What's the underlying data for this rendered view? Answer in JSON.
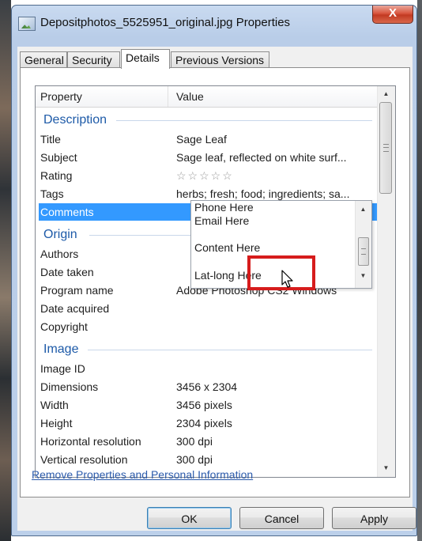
{
  "window": {
    "title": "Depositphotos_5525951_original.jpg Properties",
    "close_label": "X"
  },
  "tabs": [
    {
      "label": "General"
    },
    {
      "label": "Security"
    },
    {
      "label": "Details",
      "active": true
    },
    {
      "label": "Previous Versions"
    }
  ],
  "list": {
    "header": {
      "property": "Property",
      "value": "Value"
    },
    "groups": {
      "description": "Description",
      "origin": "Origin",
      "image": "Image"
    },
    "description_rows": [
      {
        "property": "Title",
        "value": "Sage Leaf"
      },
      {
        "property": "Subject",
        "value": "Sage leaf, reflected on white surf..."
      },
      {
        "property": "Rating",
        "value": "☆☆☆☆☆"
      },
      {
        "property": "Tags",
        "value": "herbs; fresh; food; ingredients; sa..."
      },
      {
        "property": "Comments",
        "value": ""
      }
    ],
    "origin_rows": [
      {
        "property": "Authors",
        "value": ""
      },
      {
        "property": "Date taken",
        "value": ""
      },
      {
        "property": "Program name",
        "value": "Adobe Photoshop CS2 Windows"
      },
      {
        "property": "Date acquired",
        "value": ""
      },
      {
        "property": "Copyright",
        "value": ""
      }
    ],
    "image_rows": [
      {
        "property": "Image ID",
        "value": ""
      },
      {
        "property": "Dimensions",
        "value": "3456 x 2304"
      },
      {
        "property": "Width",
        "value": "3456 pixels"
      },
      {
        "property": "Height",
        "value": "2304 pixels"
      },
      {
        "property": "Horizontal resolution",
        "value": "300 dpi"
      },
      {
        "property": "Vertical resolution",
        "value": "300 dpi"
      }
    ]
  },
  "comments_editor": {
    "lines": [
      "Phone Here",
      "Email Here",
      "Content Here",
      "Lat-long Here"
    ]
  },
  "footer": {
    "link": "Remove Properties and Personal Information",
    "ok": "OK",
    "cancel": "Cancel",
    "apply": "Apply"
  },
  "colors": {
    "selection": "#3399ff",
    "group_heading": "#1d5aa8",
    "highlight_box": "#d61c1c",
    "link": "#2c5bab"
  }
}
